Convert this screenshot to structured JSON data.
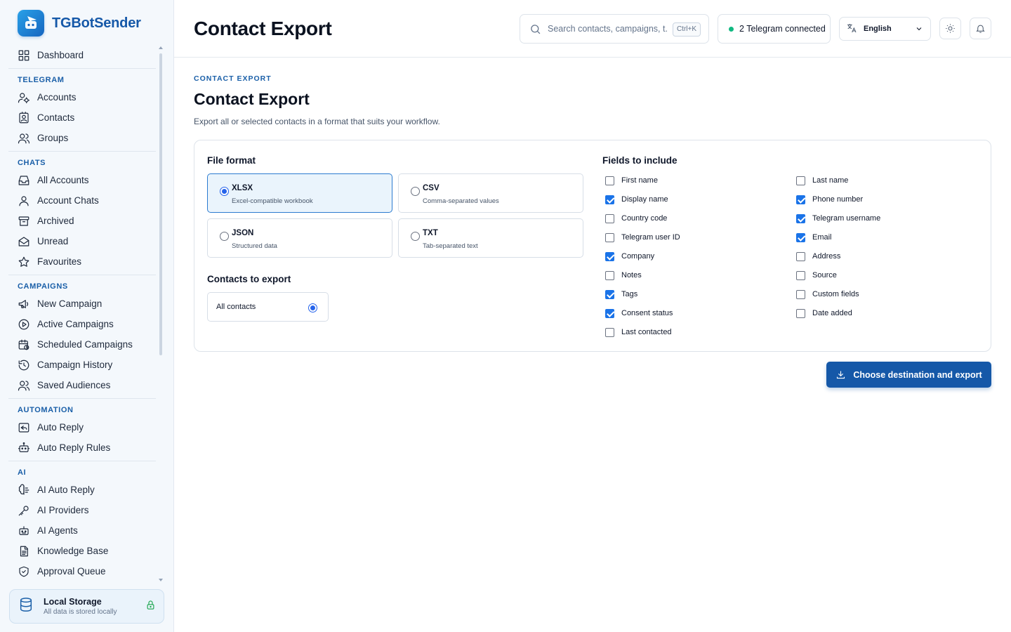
{
  "app": {
    "name": "TGBotSender"
  },
  "sidebar": {
    "dashboard": "Dashboard",
    "sections": [
      {
        "title": "TELEGRAM",
        "items": [
          {
            "label": "Accounts",
            "icon": "accounts-icon"
          },
          {
            "label": "Contacts",
            "icon": "contacts-icon"
          },
          {
            "label": "Groups",
            "icon": "groups-icon"
          }
        ]
      },
      {
        "title": "CHATS",
        "items": [
          {
            "label": "All Accounts",
            "icon": "inbox-icon"
          },
          {
            "label": "Account Chats",
            "icon": "user-icon"
          },
          {
            "label": "Archived",
            "icon": "archive-icon"
          },
          {
            "label": "Unread",
            "icon": "envelope-open-icon"
          },
          {
            "label": "Favourites",
            "icon": "star-icon"
          }
        ]
      },
      {
        "title": "CAMPAIGNS",
        "items": [
          {
            "label": "New Campaign",
            "icon": "megaphone-icon"
          },
          {
            "label": "Active Campaigns",
            "icon": "play-circle-icon"
          },
          {
            "label": "Scheduled Campaigns",
            "icon": "calendar-clock-icon"
          },
          {
            "label": "Campaign History",
            "icon": "history-icon"
          },
          {
            "label": "Saved Audiences",
            "icon": "audience-icon"
          }
        ]
      },
      {
        "title": "AUTOMATION",
        "items": [
          {
            "label": "Auto Reply",
            "icon": "reply-icon"
          },
          {
            "label": "Auto Reply Rules",
            "icon": "bot-icon"
          }
        ]
      },
      {
        "title": "AI",
        "items": [
          {
            "label": "AI Auto Reply",
            "icon": "brain-icon"
          },
          {
            "label": "AI Providers",
            "icon": "key-icon"
          },
          {
            "label": "AI Agents",
            "icon": "agent-icon"
          },
          {
            "label": "Knowledge Base",
            "icon": "document-icon"
          },
          {
            "label": "Approval Queue",
            "icon": "shield-check-icon"
          }
        ]
      }
    ],
    "storage": {
      "title": "Local Storage",
      "subtitle": "All data is stored locally"
    }
  },
  "header": {
    "title": "Contact Export",
    "search_placeholder": "Search contacts, campaigns, t...",
    "search_shortcut": "Ctrl+K",
    "telegram_status": "2 Telegram connected",
    "language": "English"
  },
  "main": {
    "eyebrow": "CONTACT EXPORT",
    "title": "Contact Export",
    "description": "Export all or selected contacts in a format that suits your workflow.",
    "file_format_title": "File format",
    "formats": [
      {
        "name": "XLSX",
        "desc": "Excel-compatible workbook",
        "selected": true
      },
      {
        "name": "CSV",
        "desc": "Comma-separated values",
        "selected": false
      },
      {
        "name": "JSON",
        "desc": "Structured data",
        "selected": false
      },
      {
        "name": "TXT",
        "desc": "Tab-separated text",
        "selected": false
      }
    ],
    "contacts_title": "Contacts to export",
    "contacts_option": "All contacts",
    "fields_title": "Fields to include",
    "fields_left": [
      {
        "label": "First name",
        "checked": false
      },
      {
        "label": "Display name",
        "checked": true
      },
      {
        "label": "Country code",
        "checked": false
      },
      {
        "label": "Telegram user ID",
        "checked": false
      },
      {
        "label": "Company",
        "checked": true
      },
      {
        "label": "Notes",
        "checked": false
      },
      {
        "label": "Tags",
        "checked": true
      },
      {
        "label": "Consent status",
        "checked": true
      },
      {
        "label": "Last contacted",
        "checked": false
      }
    ],
    "fields_right": [
      {
        "label": "Last name",
        "checked": false
      },
      {
        "label": "Phone number",
        "checked": true
      },
      {
        "label": "Telegram username",
        "checked": true
      },
      {
        "label": "Email",
        "checked": true
      },
      {
        "label": "Address",
        "checked": false
      },
      {
        "label": "Source",
        "checked": false
      },
      {
        "label": "Custom fields",
        "checked": false
      },
      {
        "label": "Date added",
        "checked": false
      }
    ],
    "export_button": "Choose destination and export"
  }
}
